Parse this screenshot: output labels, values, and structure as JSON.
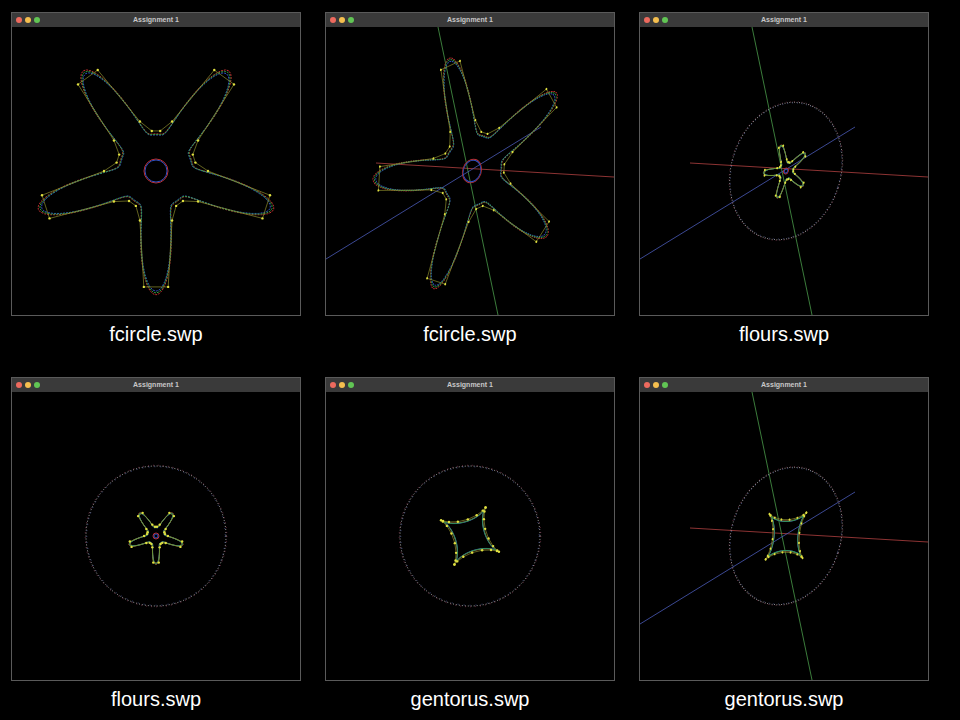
{
  "panels": [
    {
      "window": {
        "title": "Assignment 1"
      },
      "caption": "fcircle.swp",
      "figure": {
        "kind": "flower",
        "view": "front",
        "axes": false,
        "ring": false
      }
    },
    {
      "window": {
        "title": "Assignment 1"
      },
      "caption": "fcircle.swp",
      "figure": {
        "kind": "flower",
        "view": "tilted",
        "axes": true,
        "ring": false
      }
    },
    {
      "window": {
        "title": "Assignment 1"
      },
      "caption": "flours.swp",
      "figure": {
        "kind": "flower",
        "view": "tilted",
        "axes": true,
        "ring": true
      }
    },
    {
      "window": {
        "title": "Assignment 1"
      },
      "caption": "flours.swp",
      "figure": {
        "kind": "flower",
        "view": "front",
        "axes": false,
        "ring": true
      }
    },
    {
      "window": {
        "title": "Assignment 1"
      },
      "caption": "gentorus.swp",
      "figure": {
        "kind": "star",
        "view": "front",
        "axes": false,
        "ring": true
      }
    },
    {
      "window": {
        "title": "Assignment 1"
      },
      "caption": "gentorus.swp",
      "figure": {
        "kind": "star",
        "view": "tilted",
        "axes": true,
        "ring": true
      }
    }
  ]
}
